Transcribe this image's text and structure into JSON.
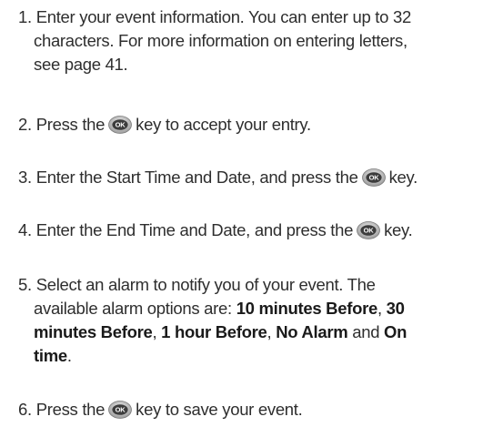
{
  "steps": [
    {
      "num": "1.",
      "lines": [
        "Enter your event information. You can enter up to 32",
        "characters. For more information on entering letters,",
        "see page 41."
      ]
    },
    {
      "num": "2.",
      "before": "Press the",
      "after": "key to accept your entry."
    },
    {
      "num": "3.",
      "before": "Enter the Start Time and Date, and press the",
      "after": "key."
    },
    {
      "num": "4.",
      "before": "Enter the End Time and Date, and press the",
      "after": "key."
    },
    {
      "num": "5.",
      "line1": "Select an alarm to notify you of your event. The",
      "line2_text": "available alarm options are:",
      "opt1": "10 minutes Before",
      "sep1": ",",
      "opt2a": "30",
      "opt2b": "minutes Before",
      "sep2": ",",
      "opt3": "1 hour Before",
      "sep3": ",",
      "opt4": "No Alarm",
      "and": "and",
      "opt5a": "On",
      "opt5b": "time",
      "end": "."
    },
    {
      "num": "6.",
      "before": "Press the",
      "after": "key to save your event."
    }
  ],
  "ok_key": {
    "label": "OK",
    "icon": "ok-key-icon"
  }
}
